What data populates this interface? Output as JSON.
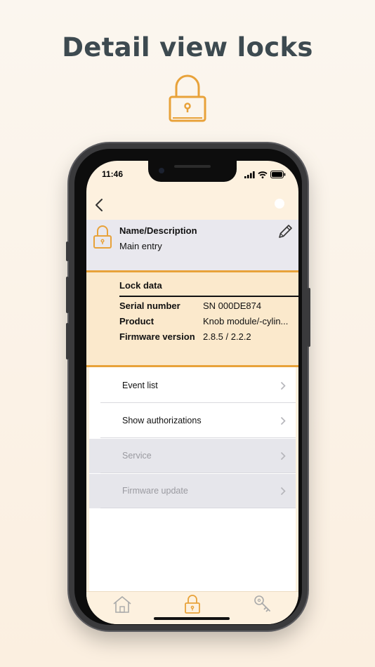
{
  "headline": "Detail view locks",
  "colors": {
    "accent": "#e8a23a",
    "panel_gray": "#e9e8ee",
    "lockdata_bg": "#fbe9cc",
    "headline": "#3d4a50"
  },
  "hero_icon": "padlock-outline-icon",
  "status_bar": {
    "time": "11:46",
    "icons": [
      "cellular-signal-icon",
      "wifi-icon",
      "battery-icon"
    ]
  },
  "nav": {
    "back_icon": "chevron-left-icon"
  },
  "lock_header": {
    "icon": "padlock-icon",
    "label": "Name/Description",
    "value": "Main entry",
    "edit_icon": "pencil-icon"
  },
  "lock_data": {
    "title": "Lock data",
    "rows": [
      {
        "key": "Serial number",
        "value": "SN 000DE874"
      },
      {
        "key": "Product",
        "value": "Knob module/-cylin..."
      },
      {
        "key": "Firmware version",
        "value": "2.8.5 / 2.2.2"
      }
    ]
  },
  "menu": [
    {
      "label": "Event list",
      "enabled": true
    },
    {
      "label": "Show authorizations",
      "enabled": true
    },
    {
      "label": "Service",
      "enabled": false
    },
    {
      "label": "Firmware update",
      "enabled": false
    }
  ],
  "tabbar": {
    "tabs": [
      {
        "icon": "home-icon",
        "active": false
      },
      {
        "icon": "lock-icon",
        "active": true
      },
      {
        "icon": "key-icon",
        "active": false
      }
    ]
  }
}
